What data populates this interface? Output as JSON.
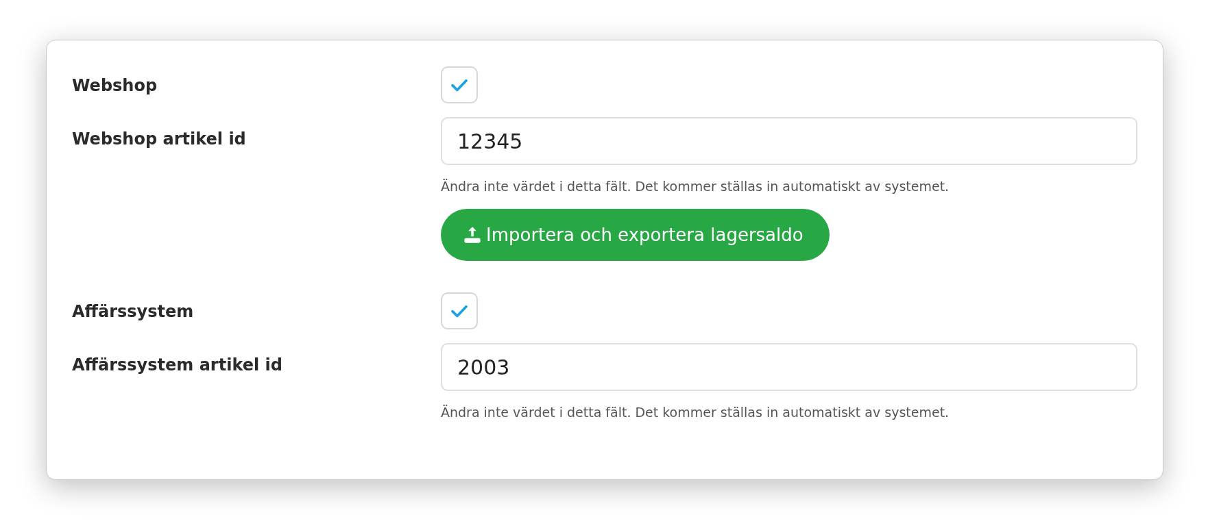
{
  "fields": [
    {
      "kind": "checkbox",
      "label": "Webshop",
      "checked": true
    },
    {
      "kind": "text",
      "label": "Webshop artikel id",
      "value": "12345",
      "help": "Ändra inte värdet i detta fält. Det kommer ställas in automatiskt av systemet.",
      "button": "Importera och exportera lagersaldo"
    },
    {
      "kind": "checkbox",
      "label": "Affärssystem",
      "checked": true
    },
    {
      "kind": "text",
      "label": "Affärssystem artikel id",
      "value": "2003",
      "help": "Ändra inte värdet i detta fält. Det kommer ställas in automatiskt av systemet."
    }
  ]
}
